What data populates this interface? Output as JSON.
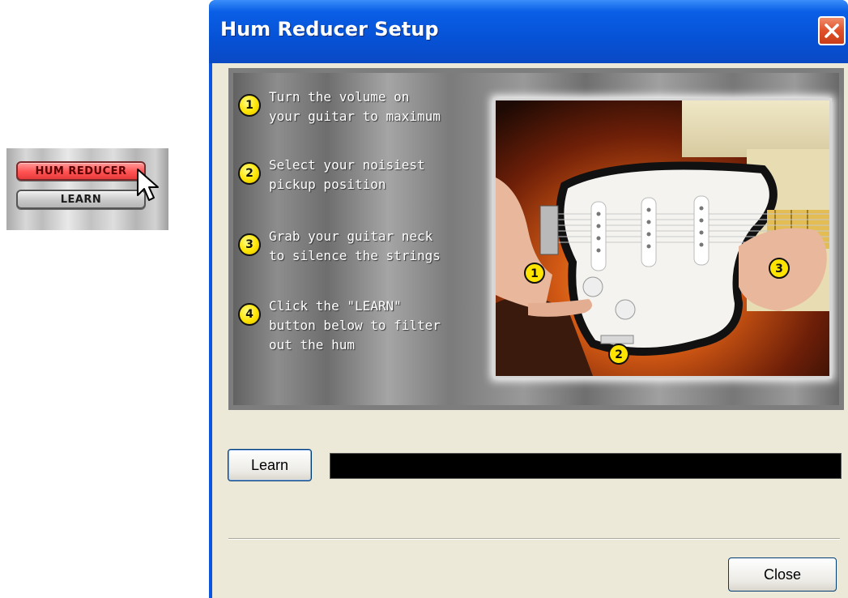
{
  "side_panel": {
    "hum_reducer_button": "HUM REDUCER",
    "learn_button": "LEARN"
  },
  "window": {
    "title": "Hum Reducer Setup"
  },
  "instructions": {
    "steps": [
      {
        "number": "1",
        "text": "Turn the volume on\nyour guitar to maximum"
      },
      {
        "number": "2",
        "text": "Select your noisiest\npickup position"
      },
      {
        "number": "3",
        "text": "Grab your guitar neck\nto silence the strings"
      },
      {
        "number": "4",
        "text": "Click the \"LEARN\"\nbutton below to filter\nout the hum"
      }
    ],
    "photo_markers": [
      "1",
      "2",
      "3"
    ]
  },
  "controls": {
    "learn_label": "Learn",
    "close_label": "Close"
  },
  "colors": {
    "titlebar": "#0a5fe6",
    "dialog_background": "#ece9d8",
    "hum_reducer_active": "#ff5353",
    "marker_yellow": "#ffe400"
  }
}
